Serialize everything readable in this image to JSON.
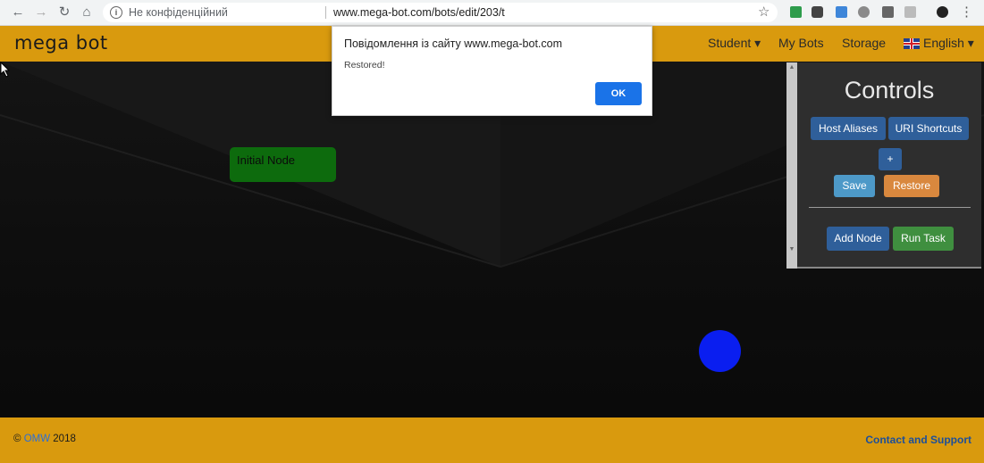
{
  "browser": {
    "not_secure_label": "Не конфіденційний",
    "url": "www.mega-bot.com/bots/edit/203/t"
  },
  "navbar": {
    "brand": "mega bot",
    "student": "Student ▾",
    "my_bots": "My Bots",
    "storage": "Storage",
    "language": "English ▾"
  },
  "canvas": {
    "initial_node_label": "Initial Node"
  },
  "controls": {
    "title": "Controls",
    "host_aliases": "Host Aliases",
    "uri_shortcuts": "URI Shortcuts",
    "plus": "+",
    "save": "Save",
    "restore": "Restore",
    "add_node": "Add Node",
    "run_task": "Run Task"
  },
  "footer": {
    "copyright_symbol": "©",
    "omw": "OMW",
    "year": "2018",
    "contact": "Contact and Support"
  },
  "dialog": {
    "title": "Повідомлення із сайту www.mega-bot.com",
    "message": "Restored!",
    "ok": "OK"
  },
  "colors": {
    "accent": "#d99a0e",
    "node_green": "#0d6b0d",
    "cursor_blue": "#0a1ef0"
  }
}
